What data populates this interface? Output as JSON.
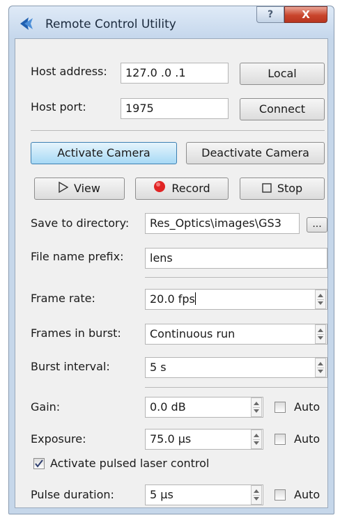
{
  "window": {
    "title": "Remote Control Utility",
    "help_label": "?",
    "close_label": "X"
  },
  "host": {
    "address_label": "Host address:",
    "address_value": "127.0  .0  .1",
    "port_label": "Host port:",
    "port_value": "1975",
    "local_button": "Local",
    "connect_button": "Connect"
  },
  "camera": {
    "activate_button": "Activate Camera",
    "deactivate_button": "Deactivate Camera",
    "view_button": "View",
    "record_button": "Record",
    "stop_button": "Stop",
    "save_dir_label": "Save to directory:",
    "save_dir_value": "Res_Optics\\images\\GS3",
    "browse_button": "...",
    "prefix_label": "File name prefix:",
    "prefix_value": "lens"
  },
  "timing": {
    "frame_rate_label": "Frame rate:",
    "frame_rate_value": "20.0 fps",
    "frames_in_burst_label": "Frames in burst:",
    "frames_in_burst_value": "Continuous run",
    "burst_interval_label": "Burst interval:",
    "burst_interval_value": "5 s"
  },
  "sensor": {
    "gain_label": "Gain:",
    "gain_value": "0.0 dB",
    "gain_auto_label": "Auto",
    "exposure_label": "Exposure:",
    "exposure_value": "75.0 µs",
    "exposure_auto_label": "Auto",
    "laser_label": "Activate pulsed laser control",
    "laser_checked": true,
    "pulse_label": "Pulse duration:",
    "pulse_value": "5 µs",
    "pulse_auto_label": "Auto"
  },
  "colors": {
    "accent": "#a7d9f5",
    "record_dot": "#e02424",
    "close_button": "#c9452c",
    "frame": "#c6d7ea"
  },
  "icons": {
    "app": "arrow-left-icon",
    "view": "play-outline-icon",
    "record": "record-dot-icon",
    "stop": "stop-square-icon"
  }
}
